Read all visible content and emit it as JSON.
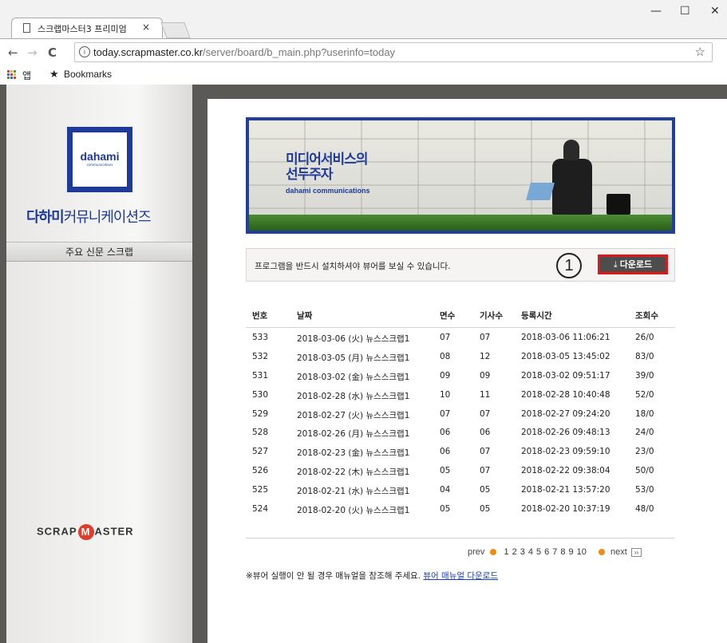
{
  "browser": {
    "tab_title": "스크랩마스터3 프리미엄",
    "tab_close": "×",
    "url_host": "today.scrapmaster.co.kr",
    "url_path": "/server/board/b_main.php?userinfo=today",
    "bookmarks": [
      {
        "label": "앱"
      },
      {
        "label": "Bookmarks"
      }
    ],
    "window_controls": [
      "—",
      "☐",
      "✕"
    ]
  },
  "sidebar": {
    "logo_text": "dahami",
    "logo_sub": "communications",
    "company_name_bold": "다하미",
    "company_name_light": "커뮤니케이션즈",
    "menu_item": "주요 신문 스크랩",
    "footer_logo_left": "SCRAP",
    "footer_logo_m": "M",
    "footer_logo_right": "ASTER"
  },
  "banner": {
    "title_line1": "미디어서비스의",
    "title_line2": "선두주자",
    "subtitle": "dahami communications"
  },
  "notice": {
    "text": "프로그램을 반드시 설치하셔야 뷰어를 보실 수 있습니다.",
    "annotation": "1",
    "download_label": "다운로드"
  },
  "table": {
    "headers": [
      "번호",
      "날짜",
      "면수",
      "기사수",
      "등록시간",
      "조회수"
    ],
    "rows": [
      [
        "533",
        "2018-03-06 (火) 뉴스스크랩1",
        "07",
        "07",
        "2018-03-06 11:06:21",
        "26/0"
      ],
      [
        "532",
        "2018-03-05 (月) 뉴스스크랩1",
        "08",
        "12",
        "2018-03-05 13:45:02",
        "83/0"
      ],
      [
        "531",
        "2018-03-02 (金) 뉴스스크랩1",
        "09",
        "09",
        "2018-03-02 09:51:17",
        "39/0"
      ],
      [
        "530",
        "2018-02-28 (水) 뉴스스크랩1",
        "10",
        "11",
        "2018-02-28 10:40:48",
        "52/0"
      ],
      [
        "529",
        "2018-02-27 (火) 뉴스스크랩1",
        "07",
        "07",
        "2018-02-27 09:24:20",
        "18/0"
      ],
      [
        "528",
        "2018-02-26 (月) 뉴스스크랩1",
        "06",
        "06",
        "2018-02-26 09:48:13",
        "24/0"
      ],
      [
        "527",
        "2018-02-23 (金) 뉴스스크랩1",
        "06",
        "07",
        "2018-02-23 09:59:10",
        "23/0"
      ],
      [
        "526",
        "2018-02-22 (木) 뉴스스크랩1",
        "05",
        "07",
        "2018-02-22 09:38:04",
        "50/0"
      ],
      [
        "525",
        "2018-02-21 (水) 뉴스스크랩1",
        "04",
        "05",
        "2018-02-21 13:57:20",
        "53/0"
      ],
      [
        "524",
        "2018-02-20 (火) 뉴스스크랩1",
        "05",
        "05",
        "2018-02-20 10:37:19",
        "48/0"
      ]
    ]
  },
  "pagination": {
    "prev_label": "prev",
    "pages": [
      "1",
      "2",
      "3",
      "4",
      "5",
      "6",
      "7",
      "8",
      "9",
      "10"
    ],
    "next_label": "next",
    "next_btn": "››"
  },
  "manual": {
    "note": "※뷰어 실행이 안 될 경우 매뉴얼을 참조해 주세요.",
    "link": "뷰어 매뉴얼 다운로드"
  },
  "colors": {
    "accent": "#1d3a9c",
    "highlight": "#e0161b",
    "pagination_dot": "#f08a10"
  }
}
